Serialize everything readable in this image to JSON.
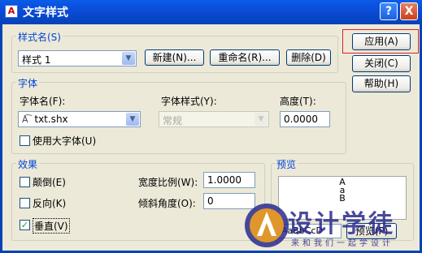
{
  "window": {
    "title": "文字样式",
    "app_icon": "A"
  },
  "title_buttons": {
    "help": "?",
    "close": "X"
  },
  "style_name": {
    "group_label": "样式名(S)",
    "selected": "样式 1",
    "new_button": "新建(N)...",
    "rename_button": "重命名(R)...",
    "delete_button": "删除(D)"
  },
  "side_buttons": {
    "apply": "应用(A)",
    "close": "关闭(C)",
    "help": "帮助(H)"
  },
  "font": {
    "group_label": "字体",
    "font_name_label": "字体名(F):",
    "font_name_value": "txt.shx",
    "font_style_label": "字体样式(Y):",
    "font_style_value": "常规",
    "height_label": "高度(T):",
    "height_value": "0.0000",
    "big_font_label": "使用大字体(U)"
  },
  "effects": {
    "group_label": "效果",
    "upside_down": "颠倒(E)",
    "backwards": "反向(K)",
    "vertical": "垂直(V)",
    "vertical_checked": true,
    "width_factor_label": "宽度比例(W):",
    "width_factor_value": "1.0000",
    "oblique_label": "倾斜角度(O):",
    "oblique_value": "0"
  },
  "preview": {
    "group_label": "预览",
    "sample_text": "AaB",
    "input_text": "AaBbCcD",
    "preview_button": "预览(P)"
  },
  "watermark": {
    "brand": "设计学徒",
    "slogan": "来和我们一起学设计"
  },
  "colors": {
    "title_bar": "#0a4bd6",
    "group_label": "#0046d5",
    "highlight": "#e02020",
    "dialog_bg": "#ece9d8"
  }
}
